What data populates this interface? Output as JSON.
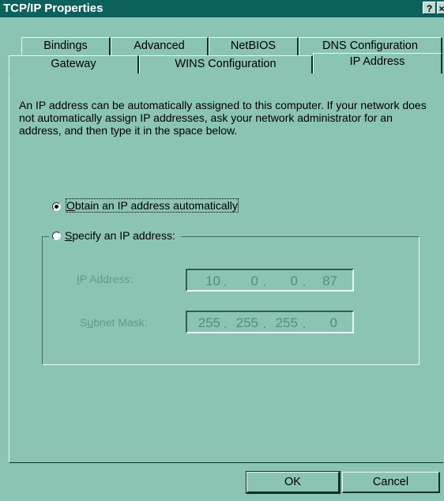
{
  "window": {
    "title": "TCP/IP Properties",
    "help_glyph": "?",
    "close_glyph": "×"
  },
  "tabs_back_row": [
    "Bindings",
    "Advanced",
    "NetBIOS",
    "DNS Configuration"
  ],
  "tabs_front_row": [
    "Gateway",
    "WINS Configuration",
    "IP Address"
  ],
  "active_tab": "IP Address",
  "description": "An IP address can be automatically assigned to this computer.  If your network does not automatically assign IP addresses, ask your network administrator for an address, and then type it in the space below.",
  "options": {
    "obtain": {
      "accesskey": "O",
      "rest": "btain an IP address automatically",
      "selected": true
    },
    "specify": {
      "accesskey": "S",
      "rest": "pecify an IP address:",
      "selected": false
    }
  },
  "fields": {
    "ip_address": {
      "label_key": "I",
      "label_rest": "P Address:",
      "octets": [
        "10",
        "0",
        "0",
        "87"
      ]
    },
    "subnet_mask": {
      "label_pre": "S",
      "label_key": "u",
      "label_rest": "bnet Mask:",
      "octets": [
        "255",
        "255",
        "255",
        "0"
      ]
    }
  },
  "buttons": {
    "ok": "OK",
    "cancel": "Cancel"
  }
}
